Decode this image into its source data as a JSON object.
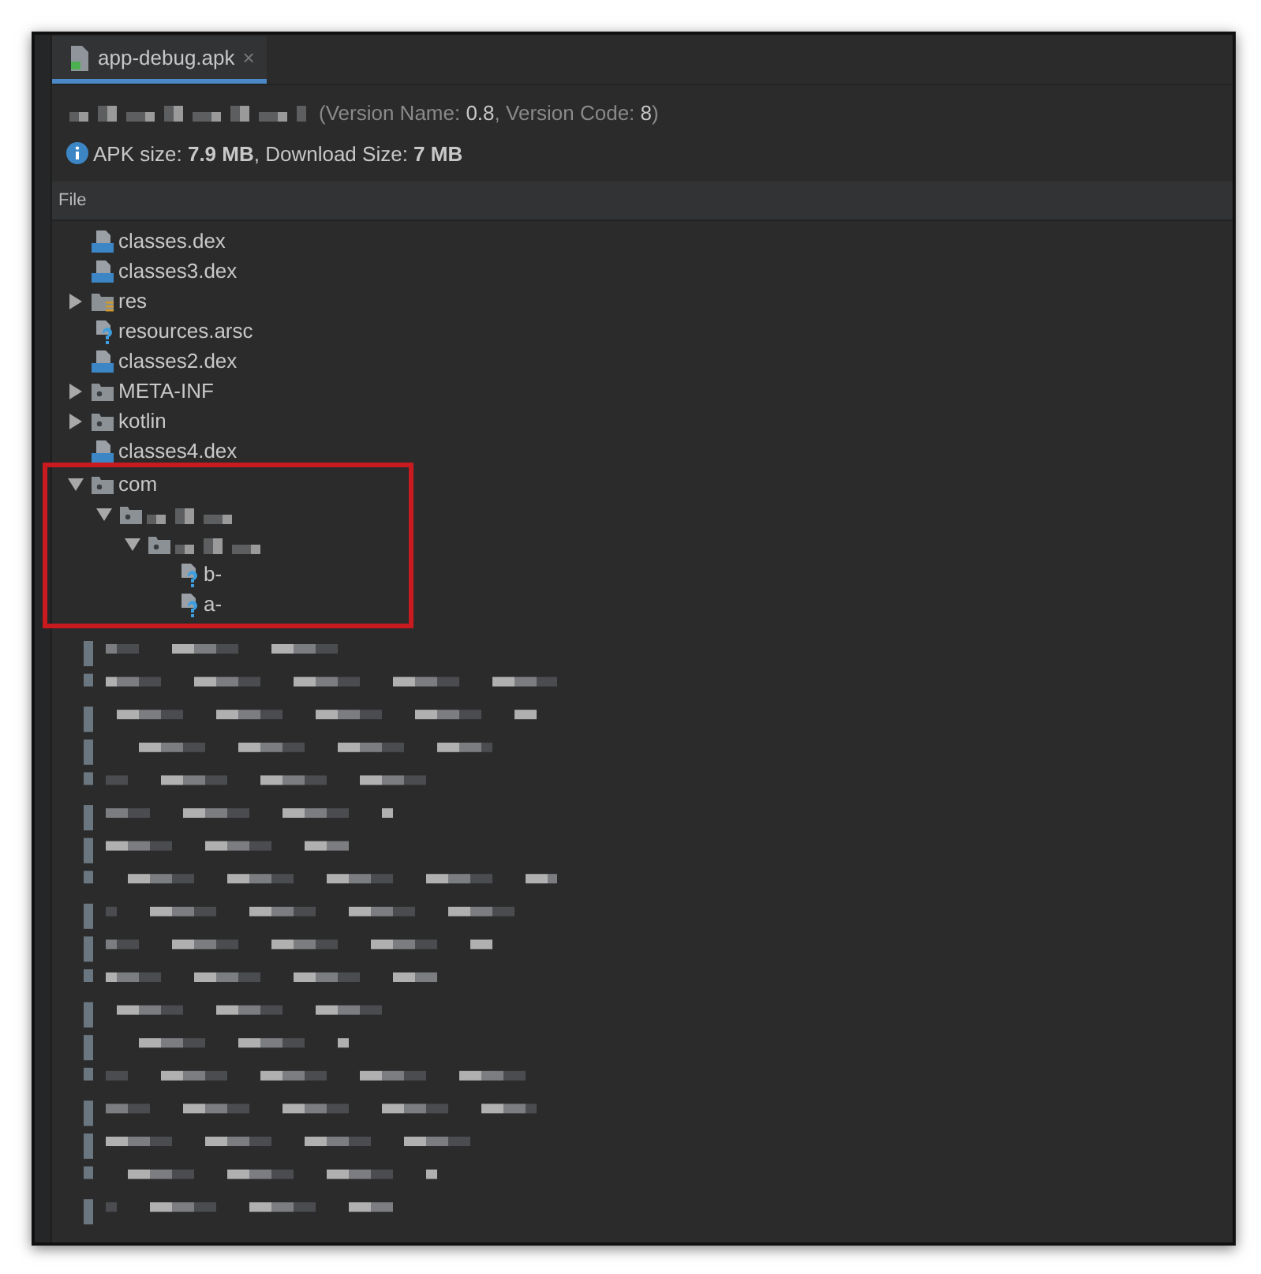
{
  "tabs": [
    {
      "label": "app-debug.apk",
      "selected": true,
      "close": "×"
    }
  ],
  "summary": {
    "version": "(Version Name: **0.8**, Version Code: **8**)",
    "size": "APK size: **7.9 MB**, Download Size: **7 MB**"
  },
  "table": {
    "columns": [
      "File"
    ]
  },
  "tree": [
    {
      "kind": "dex",
      "name": "classes.dex"
    },
    {
      "kind": "dex",
      "name": "classes3.dex"
    },
    {
      "kind": "res",
      "name": "res",
      "expanded": false
    },
    {
      "kind": "unknown",
      "name": "resources.arsc"
    },
    {
      "kind": "dex",
      "name": "classes2.dex"
    },
    {
      "kind": "folder",
      "name": "META-INF",
      "expanded": false
    },
    {
      "kind": "folder",
      "name": "kotlin",
      "expanded": false
    },
    {
      "kind": "dex",
      "name": "classes4.dex"
    },
    {
      "kind": "folder",
      "name": "com",
      "expanded": true,
      "highlighted": true,
      "children": [
        {
          "kind": "folder",
          "expanded": true,
          "children": [
            {
              "kind": "folder",
              "expanded": true,
              "children": [
                {
                  "kind": "unknown",
                  "name": "b-"
                },
                {
                  "kind": "unknown",
                  "name": "a-"
                }
              ]
            }
          ]
        }
      ]
    }
  ]
}
